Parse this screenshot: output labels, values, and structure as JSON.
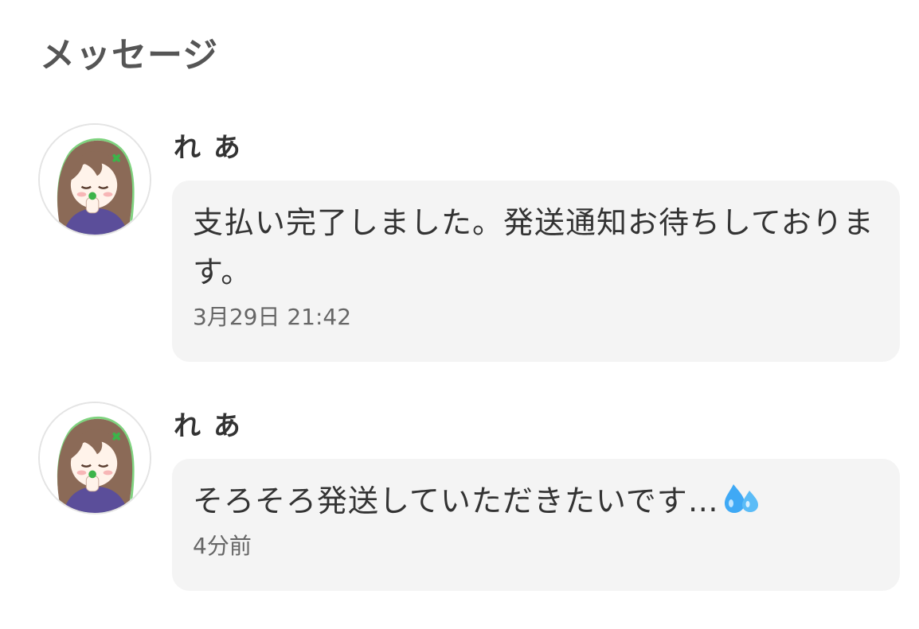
{
  "page": {
    "title": "メッセージ"
  },
  "messages": [
    {
      "sender": "れ あ",
      "text": "支払い完了しました。発送通知お待ちしております。",
      "time": "3月29日 21:42",
      "avatar_icon": "user-avatar-icon"
    },
    {
      "sender": "れ あ",
      "text": "そろそろ発送していただきたいです…",
      "emoji_icon": "sweat-droplets-icon",
      "time": "4分前",
      "avatar_icon": "user-avatar-icon"
    }
  ],
  "colors": {
    "title": "#555555",
    "bubble_bg": "#f4f4f4",
    "text": "#333333",
    "timestamp": "#666666",
    "avatar_hair": "#8b6a57",
    "avatar_clothes": "#5b4e9a",
    "clover": "#3cb44a",
    "emoji": "#3fa9f5"
  }
}
